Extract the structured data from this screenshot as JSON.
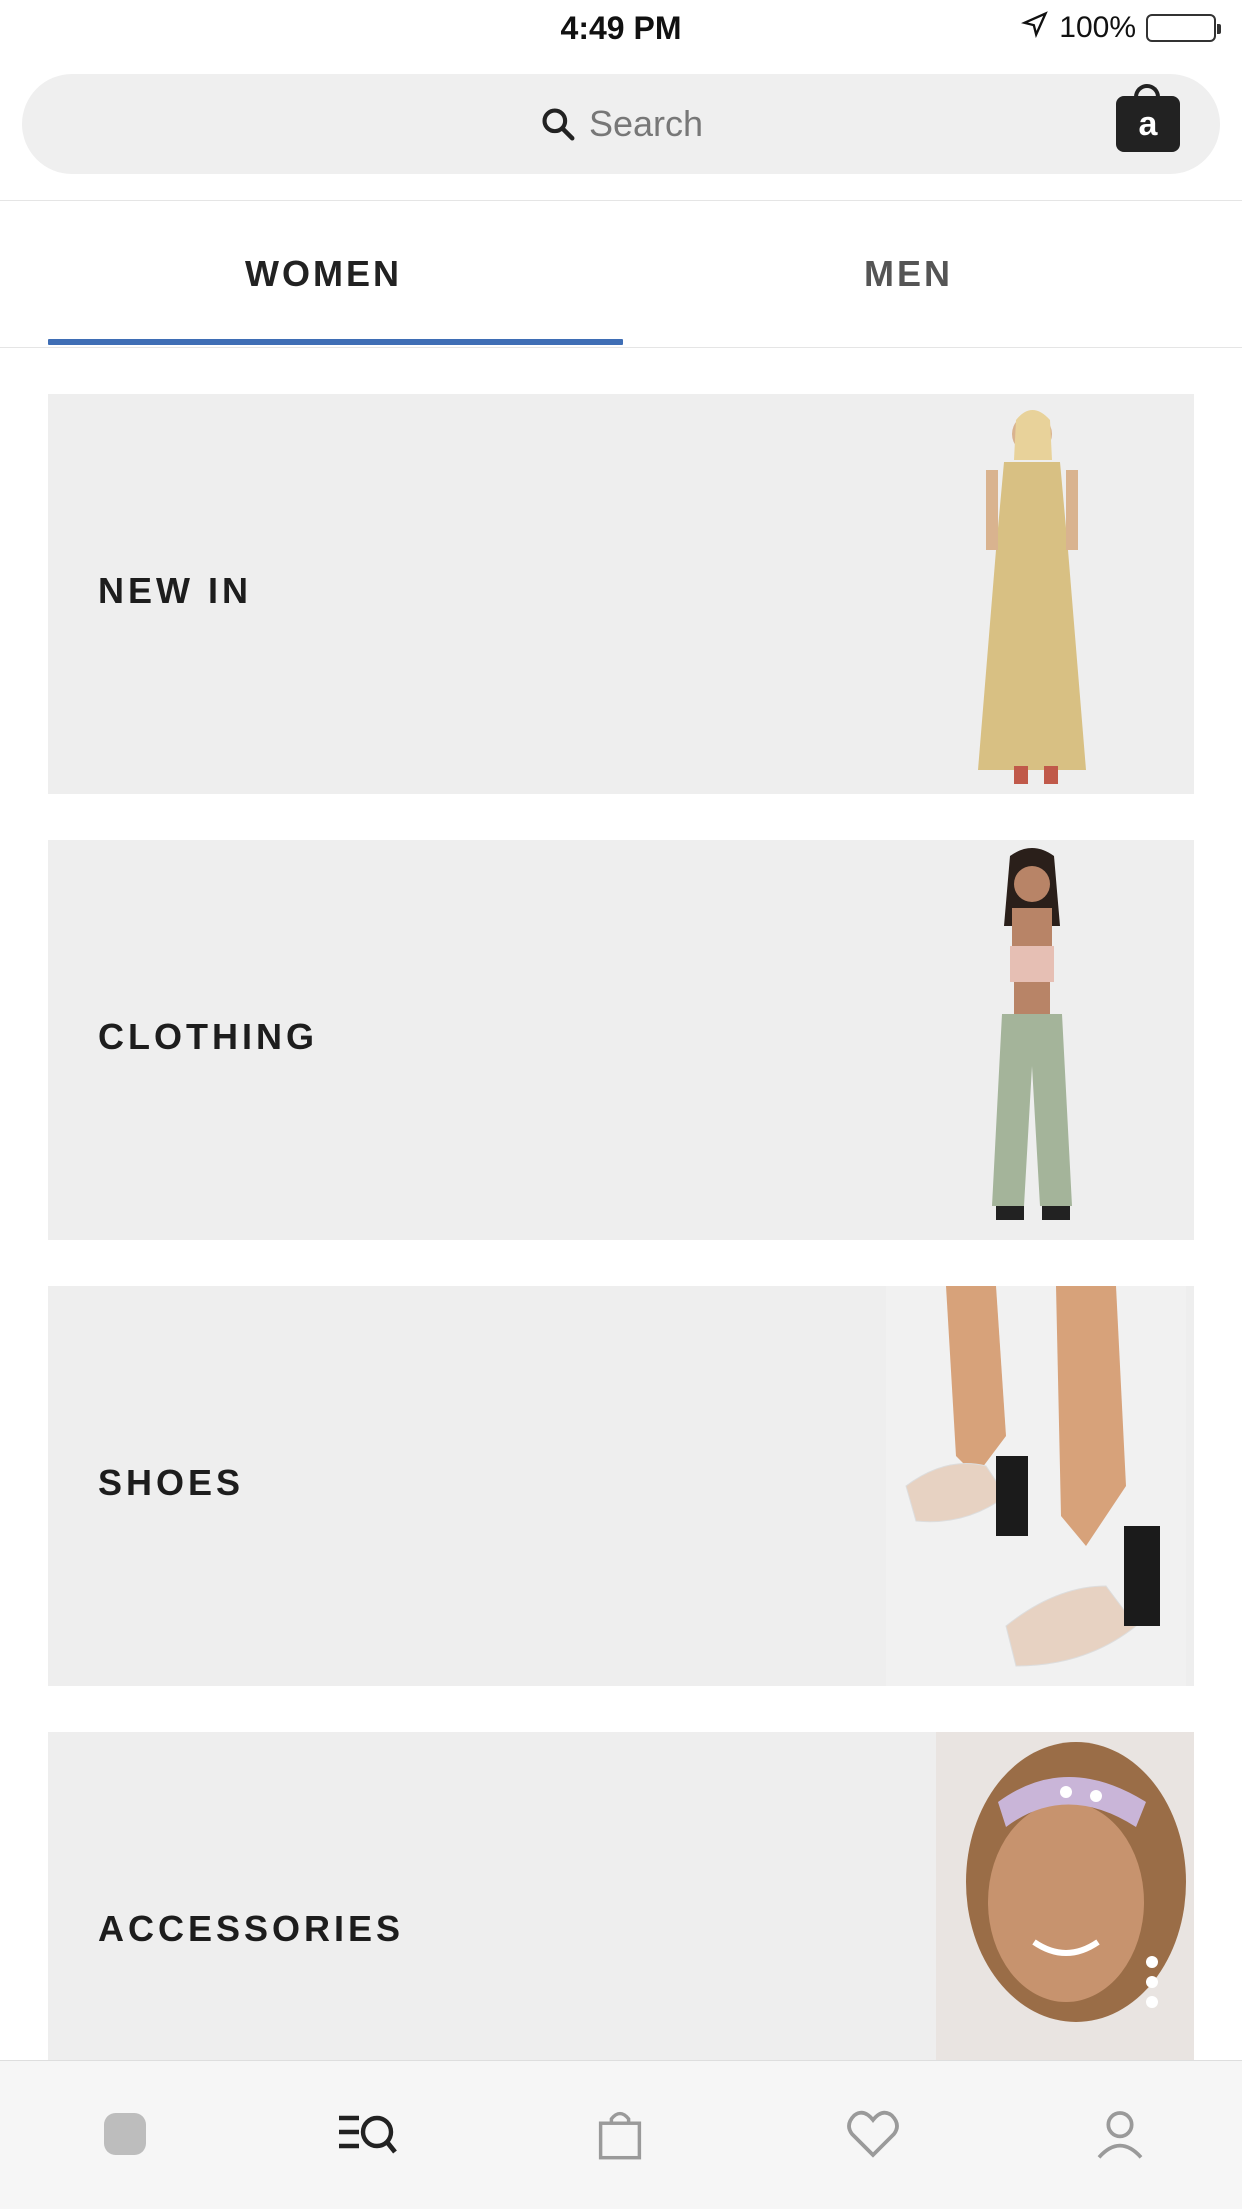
{
  "status_bar": {
    "time": "4:49 PM",
    "battery": "100%"
  },
  "search": {
    "placeholder": "Search"
  },
  "tabs": [
    {
      "label": "WOMEN",
      "active": true
    },
    {
      "label": "MEN",
      "active": false
    }
  ],
  "categories": [
    {
      "label": "NEW IN"
    },
    {
      "label": "CLOTHING"
    },
    {
      "label": "SHOES"
    },
    {
      "label": "ACCESSORIES"
    }
  ],
  "bottom_nav": [
    {
      "name": "home"
    },
    {
      "name": "search"
    },
    {
      "name": "bag"
    },
    {
      "name": "saved"
    },
    {
      "name": "account"
    }
  ],
  "colors": {
    "accent": "#3f6eb5",
    "card_bg": "#eeeeee",
    "battery": "#f6c946"
  }
}
